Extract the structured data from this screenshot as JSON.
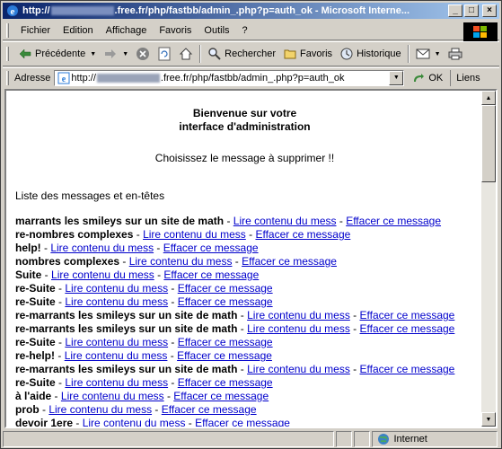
{
  "window": {
    "title_prefix": "http://",
    "title_blurred": "superdav19",
    "title_suffix": ".free.fr/php/fastbb/admin_.php?p=auth_ok - Microsoft Interne..."
  },
  "menu": [
    "Fichier",
    "Edition",
    "Affichage",
    "Favoris",
    "Outils",
    "?"
  ],
  "toolbar": {
    "back_label": "Précédente",
    "search_label": "Rechercher",
    "favorites_label": "Favoris",
    "history_label": "Historique"
  },
  "address": {
    "label": "Adresse",
    "url_prefix": "http://",
    "url_blurred": "superdav19",
    "url_suffix": ".free.fr/php/fastbb/admin_.php?p=auth_ok",
    "go_label": "OK",
    "links_label": "Liens"
  },
  "page": {
    "heading_line1": "Bienvenue sur votre",
    "heading_line2": "interface d'administration",
    "subtitle": "Choisissez le message à supprimer !!",
    "list_title": "Liste des messages et en-têtes",
    "read_link": "Lire contenu du mess",
    "delete_link": "Effacer ce message",
    "messages": [
      "marrants les smileys sur un site de math",
      "re-nombres complexes",
      "help!",
      "nombres complexes",
      "Suite",
      "re-Suite",
      "re-Suite",
      "re-marrants les smileys sur un site de math",
      "re-marrants les smileys sur un site de math",
      "re-Suite",
      "re-help!",
      "re-marrants les smileys sur un site de math",
      "re-Suite",
      "à l'aide",
      "prob",
      "devoir 1ere"
    ]
  },
  "status": {
    "zone_label": "Internet"
  }
}
